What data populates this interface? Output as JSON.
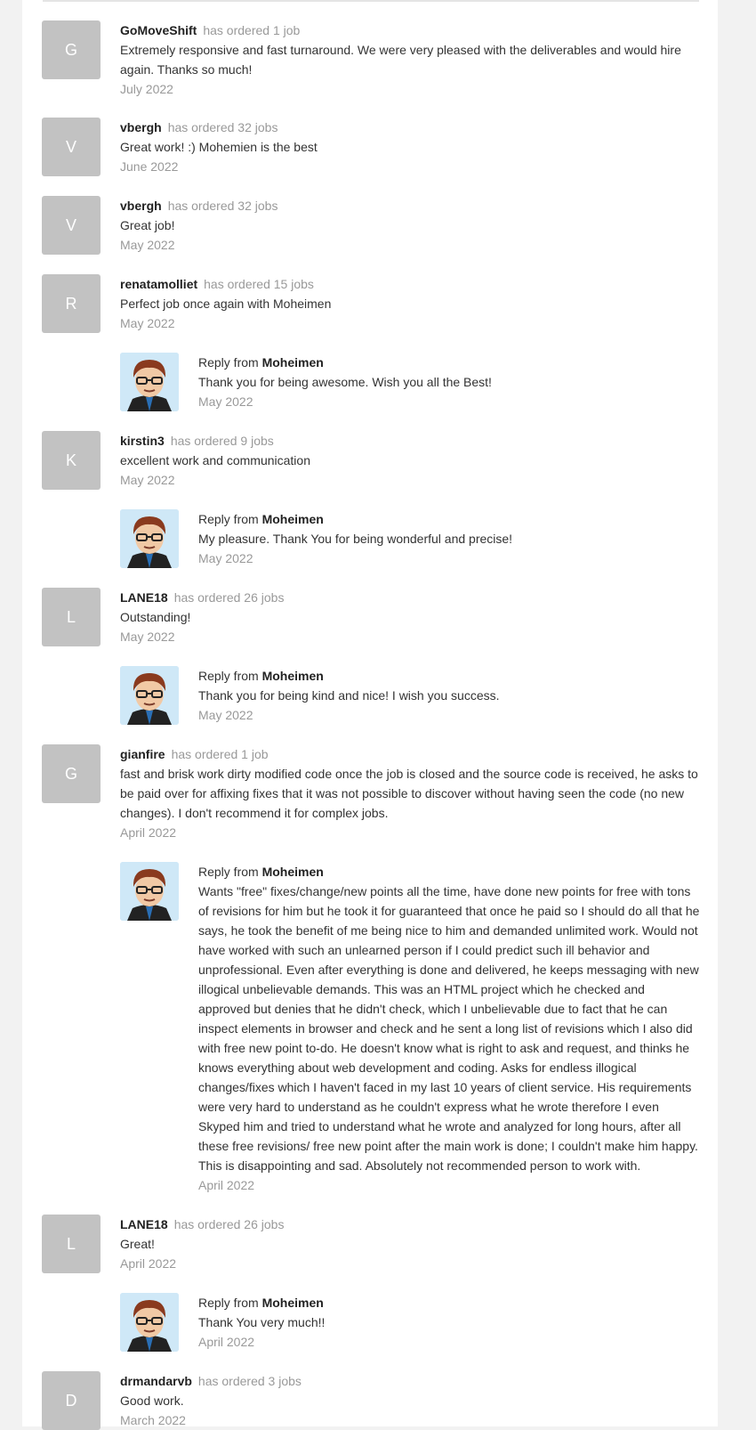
{
  "reviews": [
    {
      "initial": "G",
      "user": "GoMoveShift",
      "ordered": "has ordered 1 job",
      "text": "Extremely responsive and fast turnaround. We were very pleased with the deliverables and would hire again. Thanks so much!",
      "date": "July 2022"
    },
    {
      "initial": "V",
      "user": "vbergh",
      "ordered": "has ordered 32 jobs",
      "text": "Great work! :) Mohemien is the best",
      "date": "June 2022"
    },
    {
      "initial": "V",
      "user": "vbergh",
      "ordered": "has ordered 32 jobs",
      "text": "Great job!",
      "date": "May 2022"
    },
    {
      "initial": "R",
      "user": "renatamolliet",
      "ordered": "has ordered 15 jobs",
      "text": "Perfect job once again with Moheimen",
      "date": "May 2022",
      "reply": {
        "label": "Reply from",
        "name": "Moheimen",
        "text": "Thank you for being awesome. Wish you all the Best!",
        "date": "May 2022"
      }
    },
    {
      "initial": "K",
      "user": "kirstin3",
      "ordered": "has ordered 9 jobs",
      "text": "excellent work and communication",
      "date": "May 2022",
      "reply": {
        "label": "Reply from",
        "name": "Moheimen",
        "text": "My pleasure. Thank You for being wonderful and precise!",
        "date": "May 2022"
      }
    },
    {
      "initial": "L",
      "user": "LANE18",
      "ordered": "has ordered 26 jobs",
      "text": "Outstanding!",
      "date": "May 2022",
      "reply": {
        "label": "Reply from",
        "name": "Moheimen",
        "text": "Thank you for being kind and nice! I wish you success.",
        "date": "May 2022"
      }
    },
    {
      "initial": "G",
      "user": "gianfire",
      "ordered": "has ordered 1 job",
      "text": "fast and brisk work dirty modified code once the job is closed and the source code is received, he asks to be paid over for affixing fixes that it was not possible to discover without having seen the code (no new changes). I don't recommend it for complex jobs.",
      "date": "April 2022",
      "reply": {
        "label": "Reply from",
        "name": "Moheimen",
        "text": "Wants \"free\" fixes/change/new points all the time, have done new points for free with tons of revisions for him but he took it for guaranteed that once he paid so I should do all that he says, he took the benefit of me being nice to him and demanded unlimited work. Would not have worked with such an unlearned person if I could predict such ill behavior and unprofessional. Even after everything is done and delivered, he keeps messaging with new illogical unbelievable demands. This was an HTML project which he checked and approved but denies that he didn't check, which I unbelievable due to fact that he can inspect elements in browser and check and he sent a long list of revisions which I also did with free new point to-do. He doesn't know what is right to ask and request, and thinks he knows everything about web development and coding. Asks for endless illogical changes/fixes which I haven't faced in my last 10 years of client service. His requirements were very hard to understand as he couldn't express what he wrote therefore I even Skyped him and tried to understand what he wrote and analyzed for long hours, after all these free revisions/ free new point after the main work is done; I couldn't make him happy. This is disappointing and sad. Absolutely not recommended person to work with.",
        "date": "April 2022"
      }
    },
    {
      "initial": "L",
      "user": "LANE18",
      "ordered": "has ordered 26 jobs",
      "text": "Great!",
      "date": "April 2022",
      "reply": {
        "label": "Reply from",
        "name": "Moheimen",
        "text": "Thank You very much!!",
        "date": "April 2022"
      }
    },
    {
      "initial": "D",
      "user": "drmandarvb",
      "ordered": "has ordered 3 jobs",
      "text": "Good work.",
      "date": "March 2022"
    }
  ]
}
